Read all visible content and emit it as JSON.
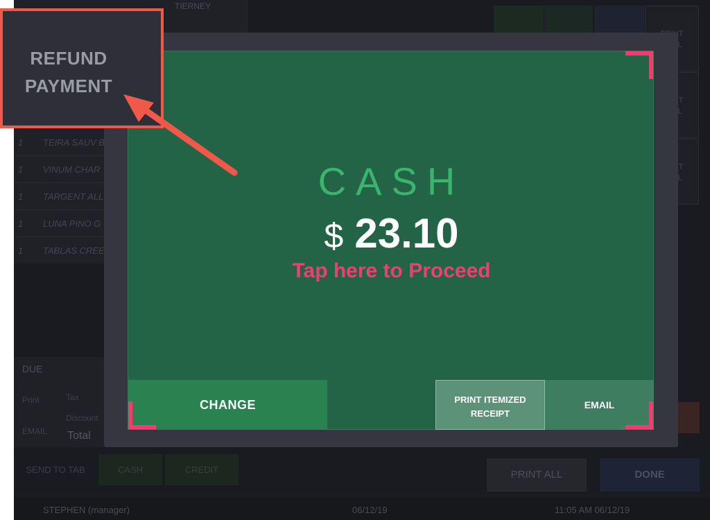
{
  "background": {
    "header_name": "TIERNEY",
    "order_items": [
      {
        "qty": "1",
        "name": "TEIRA SAUV B"
      },
      {
        "qty": "1",
        "name": "VINUM CHAR"
      },
      {
        "qty": "1",
        "name": "TARGENT ALL"
      },
      {
        "qty": "1",
        "name": "LUNA PINO G"
      },
      {
        "qty": "1",
        "name": "TABLAS CREE"
      }
    ],
    "print_dual_label": "PRINT\nDUAL",
    "due_label": "DUE",
    "small_print": "Print",
    "small_email": "EMAIL",
    "tax_label": "Tax",
    "discount_label": "Discount",
    "total_label": "Total",
    "send_to_tab": "SEND TO TAB",
    "cash_tab": "CASH",
    "credit_tab": "CREDIT",
    "print_all": "PRINT ALL",
    "done": "DONE",
    "user": "STEPHEN (manager)",
    "date_mid": "06/12/19",
    "time_right": "11:05 AM 06/12/19"
  },
  "modal": {
    "method": "CASH",
    "currency": "$",
    "amount": "23.10",
    "proceed_text": "Tap here to Proceed",
    "change_button": "CHANGE",
    "print_receipt_line1": "PRINT ITEMIZED",
    "print_receipt_line2": "RECEIPT",
    "email_button": "EMAIL"
  },
  "callout": {
    "line1": "REFUND",
    "line2": "PAYMENT"
  },
  "colors": {
    "panel": "#236447",
    "cash_title": "#39b56d",
    "proceed": "#e84270",
    "corner": "#ee3e6e",
    "callout_border": "#f0594a"
  }
}
